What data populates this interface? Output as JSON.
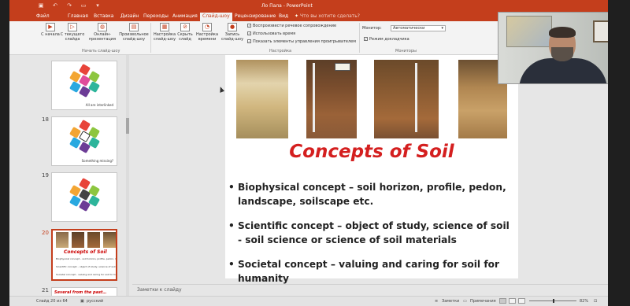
{
  "window": {
    "title": "Ло Пала - PowerPoint"
  },
  "tabs": [
    {
      "label": "Файл"
    },
    {
      "label": "Главная"
    },
    {
      "label": "Вставка"
    },
    {
      "label": "Дизайн"
    },
    {
      "label": "Переходы"
    },
    {
      "label": "Анимация"
    },
    {
      "label": "Слайд-шоу",
      "active": true
    },
    {
      "label": "Рецензирование"
    },
    {
      "label": "Вид"
    }
  ],
  "tell_me": "Что вы хотите сделать?",
  "ribbon": {
    "start": {
      "from_beginning": "С начала",
      "from_current": "С текущего слайда",
      "online": "Онлайн-презентация",
      "custom": "Произвольное слайд-шоу",
      "group": "Начать слайд-шоу"
    },
    "setup": {
      "setup_btn": "Настройка слайд-шоу",
      "hide_btn": "Скрыть слайд",
      "timing_btn": "Настройка времени",
      "record_btn": "Запись слайд-шоу",
      "chk_narration": "Воспроизвести речевое сопровождение",
      "chk_timings": "Использовать время",
      "chk_controls": "Показать элементы управления проигрывателем",
      "group": "Настройка"
    },
    "monitors": {
      "monitor_label": "Монитор:",
      "monitor_value": "Автоматически",
      "presenter_view": "Режим докладчика",
      "group": "Мониторы"
    }
  },
  "thumbnails": [
    {
      "num": "18",
      "caption": "Something missing?"
    },
    {
      "num": "19",
      "caption": ""
    },
    {
      "num": "20",
      "title": "Concepts of Soil"
    },
    {
      "num": "21",
      "title": "Several from the past…"
    }
  ],
  "thumb17_caption": "All are interlinked",
  "slide": {
    "title": "Concepts of Soil",
    "bullets": [
      "Biophysical concept – soil horizon, profile, pedon, landscape, soilscape etc.",
      "Scientific concept – object of study, science of soil - soil science or science of soil materials",
      "Societal concept – valuing and caring for soil for humanity"
    ]
  },
  "notes_placeholder": "Заметки к слайду",
  "status": {
    "slide_counter": "Слайд 20 из 64",
    "language": "русский",
    "notes_btn": "Заметки",
    "comments_btn": "Примечания",
    "zoom": "82%"
  },
  "colors": {
    "accent": "#c43e1c",
    "title_red": "#d41f1f"
  }
}
